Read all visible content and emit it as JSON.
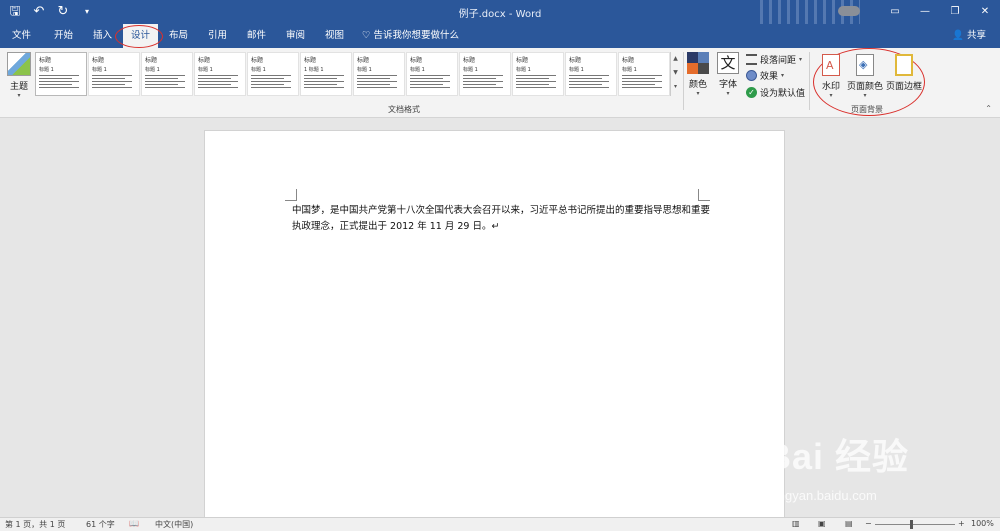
{
  "window": {
    "title": "例子.docx  -  Word",
    "qat": [
      "save-icon",
      "undo-icon",
      "redo-icon",
      "customize-icon"
    ],
    "controls": [
      "minimize",
      "restore",
      "close"
    ]
  },
  "tabs": [
    "文件",
    "开始",
    "插入",
    "设计",
    "布局",
    "引用",
    "邮件",
    "审阅",
    "视图"
  ],
  "active_tab": "设计",
  "tell_me": "告诉我你想要做什么",
  "share": "共享",
  "ribbon": {
    "theme_label": "主题",
    "style_gallery": [
      {
        "title": "标题",
        "heading": "标题 1"
      },
      {
        "title": "标题",
        "heading": "标题 1"
      },
      {
        "title": "标题",
        "heading": "标题 1"
      },
      {
        "title": "标题",
        "heading": "标题 1"
      },
      {
        "title": "标题",
        "heading": "标题 1"
      },
      {
        "title": "标题",
        "heading": "1 标题 1"
      },
      {
        "title": "标题",
        "heading": "标题 1"
      },
      {
        "title": "标题",
        "heading": "标题 1"
      },
      {
        "title": "标题",
        "heading": "标题 1"
      },
      {
        "title": "标题",
        "heading": "标题 1"
      },
      {
        "title": "标题",
        "heading": "标题 1"
      },
      {
        "title": "标题",
        "heading": "标题 1"
      }
    ],
    "doc_format_label": "文档格式",
    "colors_label": "颜色",
    "fonts_label": "字体",
    "fonts_glyph": "文",
    "paragraph_spacing": "段落间距",
    "effects": "效果",
    "set_default": "设为默认值",
    "page_background_label": "页面背景",
    "watermark": "水印",
    "page_color": "页面颜色",
    "page_borders": "页面边框"
  },
  "document": {
    "text": "中国梦，是中国共产党第十八次全国代表大会召开以来，习近平总书记所提出的重要指导思想和重要执政理念，正式提出于 2012 年 11 月 29 日。↵"
  },
  "status": {
    "page": "第 1 页，共 1 页",
    "words": "61 个字",
    "language": "中文(中国)",
    "zoom": "100%"
  },
  "watermark": {
    "logo": "Bai 经验",
    "url": "jingyan.baidu.com"
  }
}
